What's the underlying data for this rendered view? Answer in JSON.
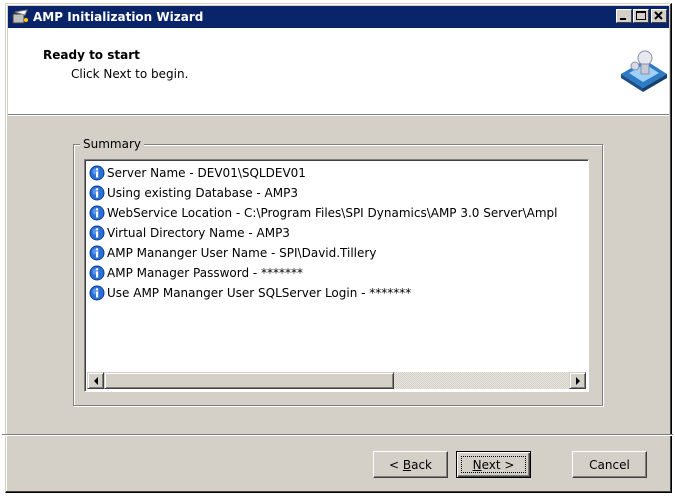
{
  "window": {
    "title": "AMP Initialization Wizard",
    "icon": "wizard-app-icon",
    "controls": [
      "minimize-icon",
      "maximize-icon",
      "close-icon"
    ]
  },
  "header": {
    "title": "Ready to start",
    "subtitle": "Click Next to begin.",
    "graphic": "wizard-banner-graphic"
  },
  "summary": {
    "label": "Summary",
    "item_icon": "info-icon",
    "items": [
      "Server Name - DEV01\\SQLDEV01",
      "Using existing Database - AMP3",
      "WebService Location - C:\\Program Files\\SPI Dynamics\\AMP 3.0 Server\\Ampl",
      "Virtual Directory Name - AMP3",
      "AMP Mananger User Name - SPI\\David.Tillery",
      "AMP Manager Password - *******",
      "Use AMP Mananger User SQLServer Login - *******"
    ]
  },
  "buttons": {
    "back_mnemonic": "B",
    "back_rest": "ack",
    "back_prefix": "< ",
    "next_mnemonic": "N",
    "next_rest": "ext >",
    "cancel": "Cancel"
  }
}
